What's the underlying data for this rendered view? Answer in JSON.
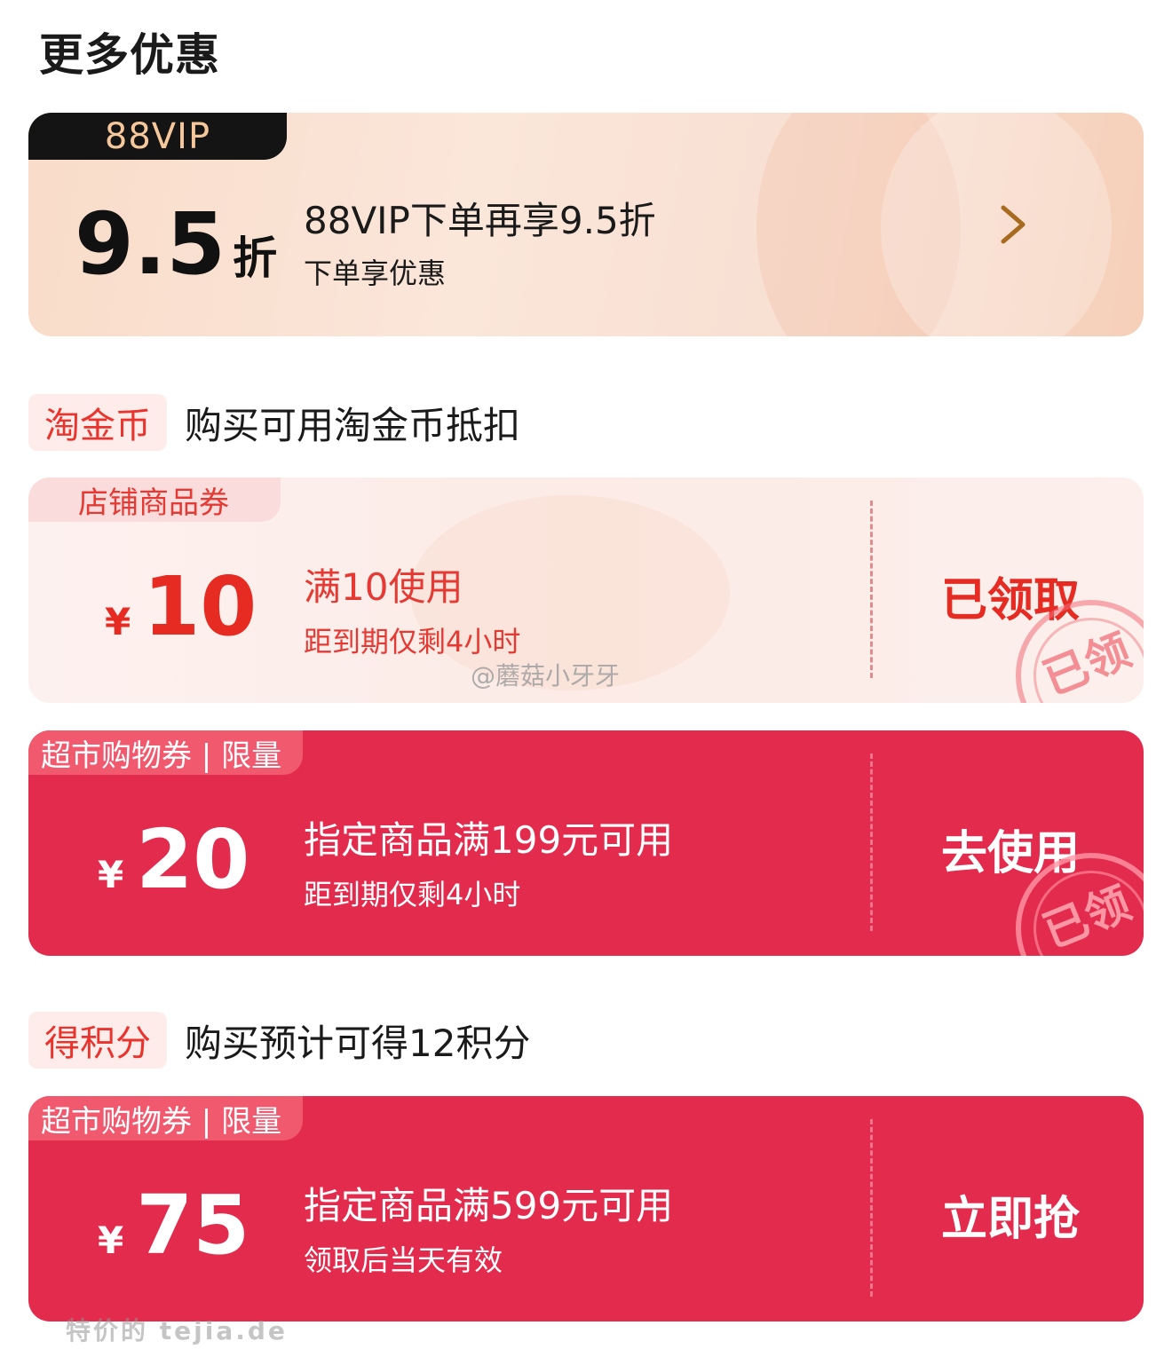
{
  "page_title": "更多优惠",
  "vip": {
    "tag": "88VIP",
    "discount_value": "9.5",
    "discount_unit": "折",
    "title": "88VIP下单再享9.5折",
    "subtitle": "下单享优惠"
  },
  "taojinbi": {
    "tag": "淘金币",
    "text": "购买可用淘金币抵扣"
  },
  "coupons": [
    {
      "tag": "店铺商品券",
      "currency": "¥",
      "amount": "10",
      "condition": "满10使用",
      "note": "距到期仅剩4小时",
      "action": "已领取",
      "stamp": "已领"
    },
    {
      "tag": "超市购物券 | 限量",
      "currency": "¥",
      "amount": "20",
      "condition": "指定商品满199元可用",
      "note": "距到期仅剩4小时",
      "action": "去使用",
      "stamp": "已领"
    },
    {
      "tag": "超市购物券 | 限量",
      "currency": "¥",
      "amount": "75",
      "condition": "指定商品满599元可用",
      "note": "领取后当天有效",
      "action": "立即抢"
    }
  ],
  "points": {
    "tag": "得积分",
    "text": "购买预计可得12积分"
  },
  "watermark": "@蘑菇小牙牙",
  "footer_watermark": "特价的 tejia.de",
  "colors": {
    "accent_red": "#e62b22",
    "coupon_red_bg": "#e32b4d",
    "vip_tag_bg": "#141414",
    "vip_tag_text": "#f6c79a"
  }
}
